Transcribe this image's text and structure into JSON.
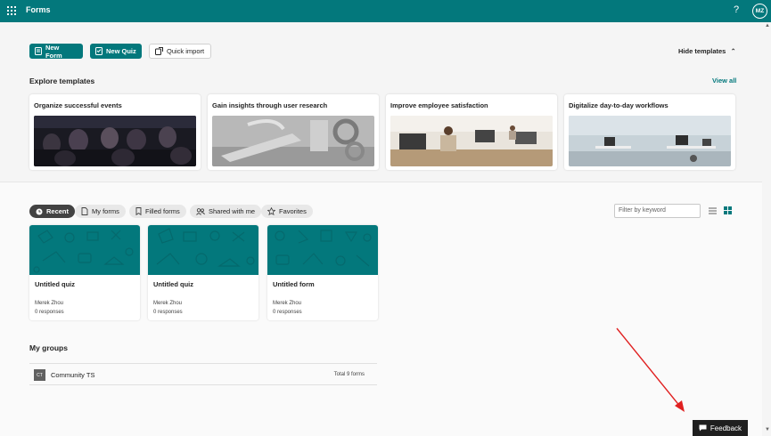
{
  "app": {
    "title": "Forms",
    "help_glyph": "?",
    "avatar_initials": "MZ"
  },
  "toolbar": {
    "new_form": "New Form",
    "new_quiz": "New Quiz",
    "quick_import": "Quick import",
    "hide_templates": "Hide templates"
  },
  "templates": {
    "heading": "Explore templates",
    "view_all": "View all",
    "cards": [
      {
        "title": "Organize successful events"
      },
      {
        "title": "Gain insights through user research"
      },
      {
        "title": "Improve employee satisfaction"
      },
      {
        "title": "Digitalize day-to-day workflows"
      }
    ]
  },
  "filters": {
    "pills": [
      "Recent",
      "My forms",
      "Filled forms",
      "Shared with me",
      "Favorites"
    ],
    "active": "Recent",
    "keyword_placeholder": "Filter by keyword"
  },
  "forms": [
    {
      "name": "Untitled quiz",
      "owner": "Merek Zhou",
      "responses": "0 responses"
    },
    {
      "name": "Untitled quiz",
      "owner": "Merek Zhou",
      "responses": "0 responses"
    },
    {
      "name": "Untitled form",
      "owner": "Merek Zhou",
      "responses": "0 responses"
    }
  ],
  "groups": {
    "heading": "My groups",
    "items": [
      {
        "badge": "CT",
        "name": "Community TS",
        "count": "Total 9 forms"
      }
    ]
  },
  "feedback": {
    "label": "Feedback"
  },
  "colors": {
    "brand": "#03787c",
    "annotation_arrow": "#e02020"
  }
}
